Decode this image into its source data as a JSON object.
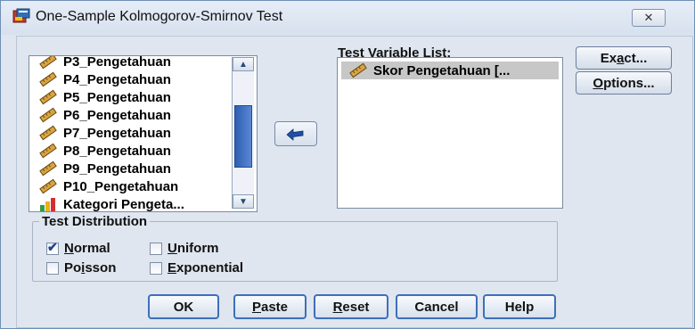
{
  "window": {
    "title": "One-Sample Kolmogorov-Smirnov Test",
    "close_glyph": "✕"
  },
  "source_list": {
    "items": [
      {
        "label": "P3_Pengetahuan",
        "icon": "ruler-icon"
      },
      {
        "label": "P4_Pengetahuan",
        "icon": "ruler-icon"
      },
      {
        "label": "P5_Pengetahuan",
        "icon": "ruler-icon"
      },
      {
        "label": "P6_Pengetahuan",
        "icon": "ruler-icon"
      },
      {
        "label": "P7_Pengetahuan",
        "icon": "ruler-icon"
      },
      {
        "label": "P8_Pengetahuan",
        "icon": "ruler-icon"
      },
      {
        "label": "P9_Pengetahuan",
        "icon": "ruler-icon"
      },
      {
        "label": "P10_Pengetahuan",
        "icon": "ruler-icon"
      },
      {
        "label": "Kategori Pengeta...",
        "icon": "bar-chart-icon"
      }
    ]
  },
  "test_variable_list": {
    "label": "Test Variable List:",
    "items": [
      {
        "label": "Skor Pengetahuan [..."
      }
    ]
  },
  "side_buttons": {
    "exact": {
      "pre": "Ex",
      "u": "a",
      "post": "ct..."
    },
    "options": {
      "pre": "",
      "u": "O",
      "post": "ptions..."
    }
  },
  "test_distribution": {
    "label": "Test Distribution",
    "normal": {
      "pre": "",
      "u": "N",
      "post": "ormal",
      "checked": true
    },
    "uniform": {
      "pre": "",
      "u": "U",
      "post": "niform",
      "checked": false
    },
    "poisson": {
      "pre": "Po",
      "u": "i",
      "post": "sson",
      "checked": false
    },
    "exponential": {
      "pre": "",
      "u": "E",
      "post": "xponential",
      "checked": false
    }
  },
  "buttons": {
    "ok": {
      "label": "OK"
    },
    "paste": {
      "pre": "",
      "u": "P",
      "post": "aste"
    },
    "reset": {
      "pre": "",
      "u": "R",
      "post": "eset"
    },
    "cancel": {
      "label": "Cancel"
    },
    "help": {
      "label": "Help"
    }
  },
  "colors": {
    "selection": "#c7c7c7",
    "accent": "#3e6fb9",
    "thumb": "#2e5fb3"
  }
}
